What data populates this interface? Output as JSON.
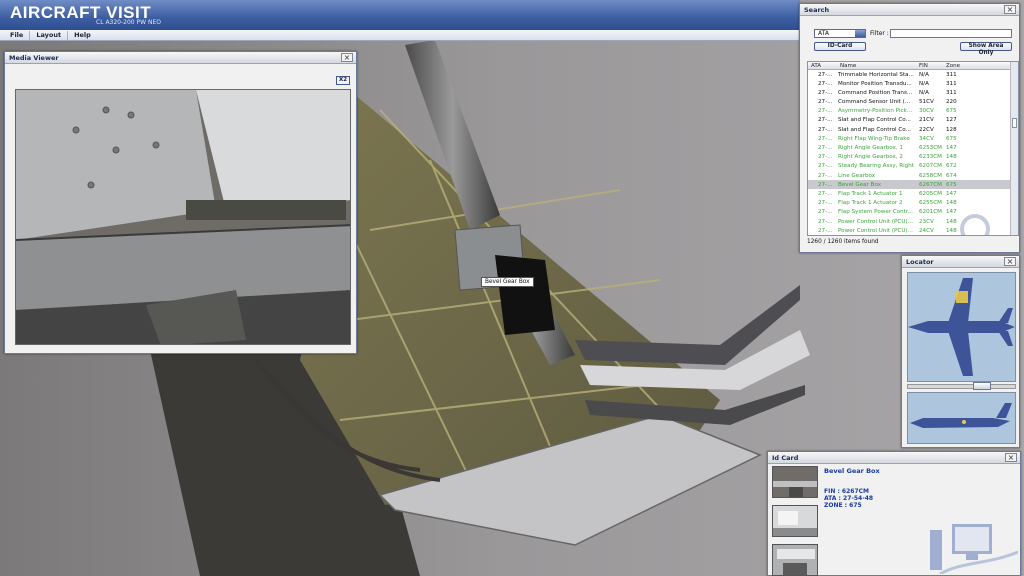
{
  "app": {
    "title": "AIRCRAFT VISIT",
    "subtitle": "CL A320-200 PW NEO",
    "menu": [
      "File",
      "Layout",
      "Help"
    ]
  },
  "media_viewer": {
    "title": "Media Viewer",
    "zoom_label": "X2"
  },
  "search": {
    "title": "Search",
    "mode_value": "ATA",
    "filter_label": "Filter :",
    "filter_value": "",
    "idcard_btn": "ID-Card",
    "showarea_btn": "Show Area Only",
    "columns": [
      "ATA",
      "Name",
      "FIN",
      "Zone"
    ],
    "rows": [
      {
        "ata": "27-...",
        "name": "Trimmable Horizontal Sta...",
        "fin": "N/A",
        "zone": "311",
        "style": "black"
      },
      {
        "ata": "27-...",
        "name": "Monitor Position Transdu...",
        "fin": "N/A",
        "zone": "311",
        "style": "black"
      },
      {
        "ata": "27-...",
        "name": "Command Position Trans...",
        "fin": "N/A",
        "zone": "311",
        "style": "black"
      },
      {
        "ata": "27-...",
        "name": "Command Sensor Unit (...",
        "fin": "51CV",
        "zone": "220",
        "style": "black"
      },
      {
        "ata": "27-...",
        "name": "Asymmetry-Position Pick...",
        "fin": "30CV",
        "zone": "675",
        "style": "green"
      },
      {
        "ata": "27-...",
        "name": "Slat and Flap Control Co...",
        "fin": "21CV",
        "zone": "127",
        "style": "black"
      },
      {
        "ata": "27-...",
        "name": "Slat and Flap Control Co...",
        "fin": "22CV",
        "zone": "128",
        "style": "black"
      },
      {
        "ata": "27-...",
        "name": "Right Flap Wing-Tip Brake",
        "fin": "34CV",
        "zone": "675",
        "style": "green"
      },
      {
        "ata": "27-...",
        "name": "Right Angle Gearbox, 1",
        "fin": "6253CM",
        "zone": "147",
        "style": "green"
      },
      {
        "ata": "27-...",
        "name": "Right Angle Gearbox, 2",
        "fin": "6233CM",
        "zone": "148",
        "style": "green"
      },
      {
        "ata": "27-...",
        "name": "Steady Bearing Assy, Right",
        "fin": "6207CM",
        "zone": "672",
        "style": "green"
      },
      {
        "ata": "27-...",
        "name": "Line Gearbox",
        "fin": "6258CM",
        "zone": "674",
        "style": "green"
      },
      {
        "ata": "27-...",
        "name": "Bevel Gear Box",
        "fin": "6267CM",
        "zone": "675",
        "style": "sel"
      },
      {
        "ata": "27-...",
        "name": "Flap Track 1 Actuator 1",
        "fin": "6205CM",
        "zone": "147",
        "style": "green"
      },
      {
        "ata": "27-...",
        "name": "Flap Track 1 Actuator 2",
        "fin": "6255CM",
        "zone": "148",
        "style": "green"
      },
      {
        "ata": "27-...",
        "name": "Flap System Power Contr...",
        "fin": "6201CM",
        "zone": "147",
        "style": "green"
      },
      {
        "ata": "27-...",
        "name": "Power Control Unit (PCU)...",
        "fin": "23CV",
        "zone": "148",
        "style": "green"
      },
      {
        "ata": "27-...",
        "name": "Power Control Unit (PCU)...",
        "fin": "24CV",
        "zone": "148",
        "style": "green"
      }
    ],
    "items_found": "1260 / 1260 items found"
  },
  "locator": {
    "title": "Locator"
  },
  "idcard": {
    "title": "Id Card",
    "name": "Bevel Gear Box",
    "fin": "FIN : 6267CM",
    "ata": "ATA : 27-54-48",
    "zone": "ZONE : 675"
  },
  "tooltip": {
    "label": "Bevel Gear Box"
  },
  "colors": {
    "title_bar": "#3d5da1",
    "green_row": "#3aa43a",
    "idcard_text": "#1a3aa0",
    "selected_row": "#c7c9cc"
  }
}
